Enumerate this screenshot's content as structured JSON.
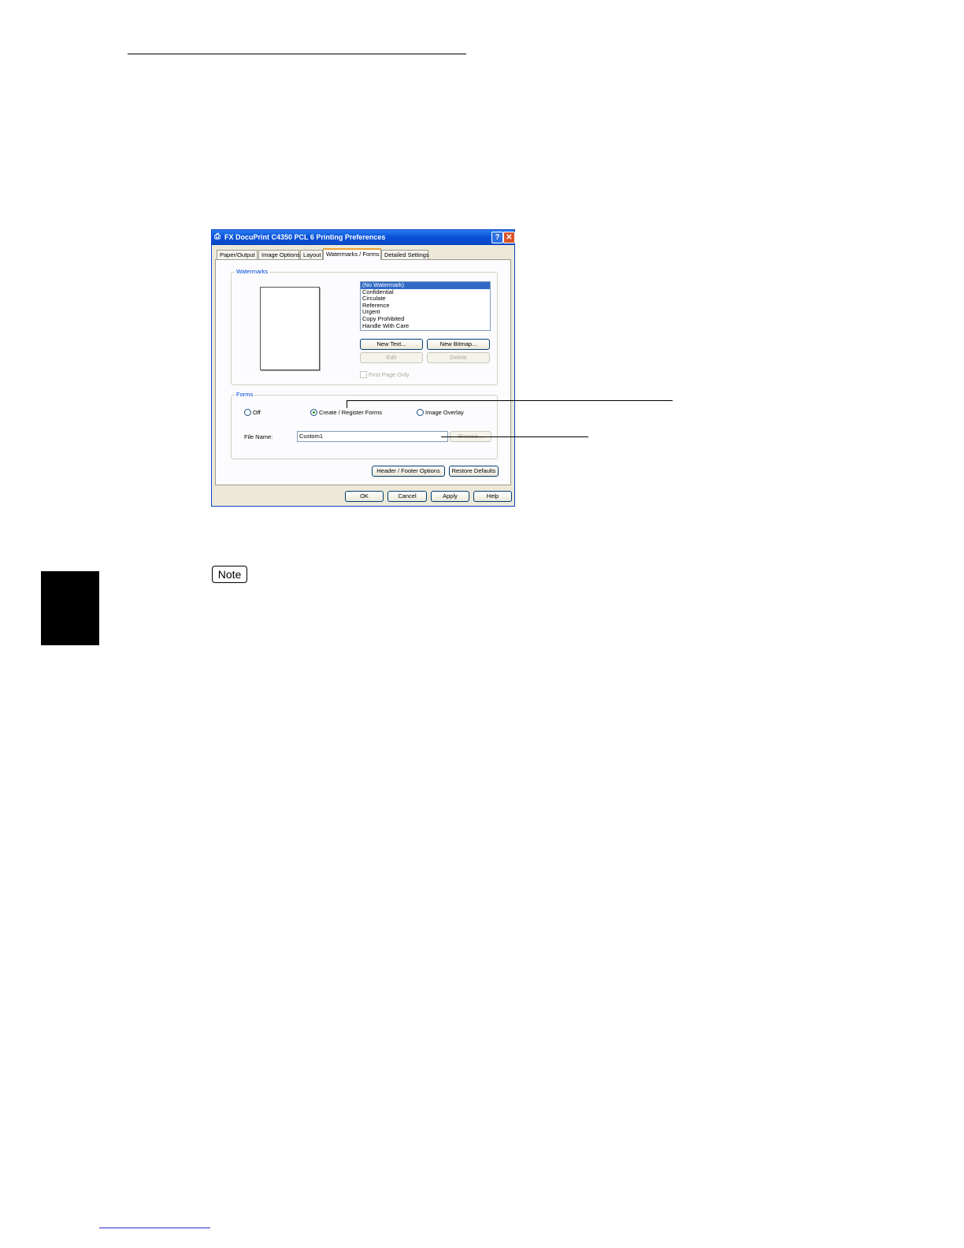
{
  "dialog": {
    "title": "FX DocuPrint C4350 PCL 6 Printing Preferences",
    "help_glyph": "?",
    "close_glyph": "✕",
    "tabs": [
      "Paper/Output",
      "Image Options",
      "Layout",
      "Watermarks / Forms",
      "Detailed Settings"
    ],
    "active_tab": "Watermarks / Forms",
    "watermarks": {
      "group_label": "Watermarks",
      "items": [
        "(No Watermark)",
        "Confidential",
        "Circulate",
        "Reference",
        "Urgent",
        "Copy Prohibited",
        "Handle With Care"
      ],
      "selected": "(No Watermark)",
      "new_text_button": "New Text...",
      "new_bitmap_button": "New Bitmap...",
      "edit_button": "Edit",
      "delete_button": "Delete",
      "first_page_only_label": "First Page Only"
    },
    "forms": {
      "group_label": "Forms",
      "options": [
        "Off",
        "Create / Register Forms",
        "Image Overlay"
      ],
      "selected": "Create / Register Forms",
      "file_name_label": "File Name:",
      "file_name_value": "Custom1",
      "browse_button": "Browse..."
    },
    "header_footer_button": "Header / Footer Options",
    "restore_defaults_button": "Restore Defaults",
    "ok_button": "OK",
    "cancel_button": "Cancel",
    "apply_button": "Apply",
    "help_button": "Help"
  },
  "note_label": "Note",
  "colors": {
    "titlebar": "#0a52d9",
    "selection": "#316ac5",
    "group_label": "#0046d5",
    "dialog_face": "#ece9d8"
  }
}
